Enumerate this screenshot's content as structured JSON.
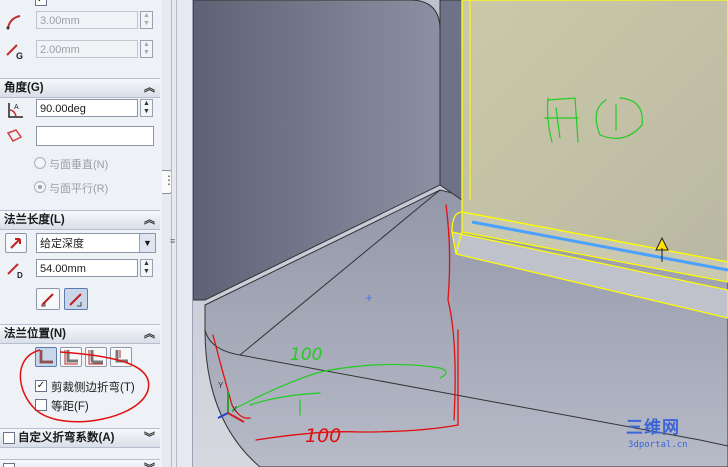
{
  "panel": {
    "top_fields": [
      {
        "value": "3.00mm"
      },
      {
        "value": "2.00mm"
      }
    ],
    "angle_section": {
      "title": "角度(G)",
      "angle_value": "90.00deg",
      "reference_value": "",
      "radio_options": [
        {
          "label": "与面垂直(N)",
          "selected": false
        },
        {
          "label": "与面平行(R)",
          "selected": true
        }
      ]
    },
    "length_section": {
      "title": "法兰长度(L)",
      "end_condition": "给定深度",
      "depth_value": "54.00mm"
    },
    "position_section": {
      "title": "法兰位置(N)",
      "trim_side_bends": {
        "label": "剪裁侧边折弯(T)",
        "checked": true
      },
      "offset": {
        "label": "等距(F)",
        "checked": false
      }
    },
    "custom_bend_section": {
      "title": "自定义折弯系数(A)",
      "checked": false
    }
  },
  "viewport": {
    "annotations": [
      {
        "text": "面1"
      },
      {
        "text": "100"
      },
      {
        "text": "100"
      }
    ]
  },
  "watermark": {
    "brand": "三维网",
    "url": "3dportal.cn"
  },
  "colors": {
    "edge_yellow": "#ffff00",
    "sketch_red": "#e01010",
    "sketch_green": "#22cc22",
    "selected_blue": "#4aa0ff"
  }
}
